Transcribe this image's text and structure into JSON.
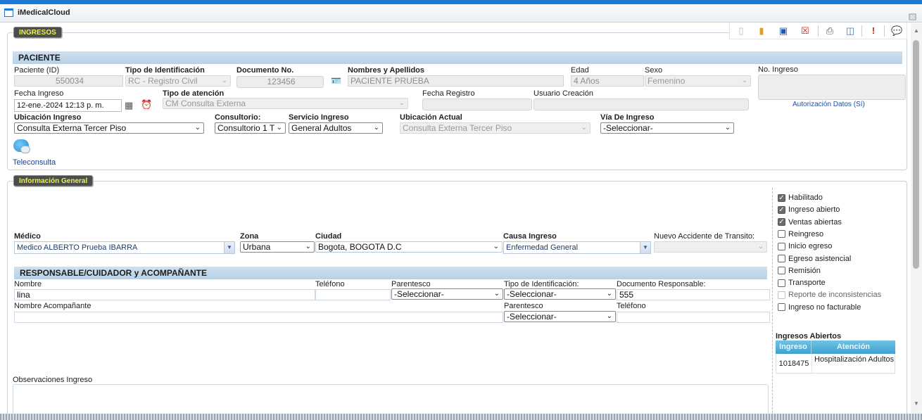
{
  "window": {
    "title": "iMedicalCloud",
    "close": "⊠"
  },
  "toolbar": {
    "icons": [
      "new-document-icon",
      "open-folder-icon",
      "save-icon",
      "delete-icon",
      "print-icon",
      "preview-icon",
      "alert-icon",
      "comment-icon"
    ]
  },
  "ingresos": {
    "title": "INGRESOS"
  },
  "paciente": {
    "header": "PACIENTE",
    "paciente_id": {
      "label": "Paciente (ID)",
      "value": "550034"
    },
    "tipo_id": {
      "label": "Tipo de Identificación",
      "value": "RC - Registro Civil"
    },
    "documento": {
      "label": "Documento No.",
      "value": "123456"
    },
    "nombres": {
      "label": "Nombres y Apellidos",
      "value": "PACIENTE  PRUEBA"
    },
    "edad": {
      "label": "Edad",
      "value": "4  Años"
    },
    "sexo": {
      "label": "Sexo",
      "value": "Femenino"
    },
    "no_ingreso": {
      "label": "No. Ingreso",
      "value": ""
    },
    "autorizacion": "Autorización Datos (Sí)",
    "fecha_ingreso": {
      "label": "Fecha Ingreso",
      "value": "12-ene.-2024 12:13 p. m."
    },
    "tipo_atencion": {
      "label": "Tipo de atención",
      "value": "CM Consulta Externa"
    },
    "fecha_registro": {
      "label": "Fecha Registro",
      "value": ""
    },
    "usuario_creacion": {
      "label": "Usuario Creación",
      "value": ""
    },
    "ubicacion_ingreso": {
      "label": "Ubicación Ingreso",
      "value": "Consulta Externa Tercer Piso"
    },
    "consultorio": {
      "label": "Consultorio:",
      "value": "Consultorio 1 T"
    },
    "servicio": {
      "label": "Servicio Ingreso",
      "value": "General Adultos"
    },
    "ubicacion_actual": {
      "label": "Ubicación Actual",
      "value": "Consulta Externa Tercer Piso"
    },
    "via_ingreso": {
      "label": "Vía De Ingreso",
      "value": "-Seleccionar-"
    },
    "teleconsulta": "Teleconsulta"
  },
  "general": {
    "title": "Información General",
    "medico": {
      "label": "Médico",
      "value": "Medico ALBERTO Prueba IBARRA"
    },
    "zona": {
      "label": "Zona",
      "value": "Urbana"
    },
    "ciudad": {
      "label": "Ciudad",
      "value": "Bogota, BOGOTA D.C"
    },
    "causa": {
      "label": "Causa Ingreso",
      "value": "Enfermedad General"
    },
    "accidente": {
      "label": "Nuevo Accidente de Transito:",
      "value": ""
    },
    "checks": [
      {
        "label": "Habilitado",
        "checked": true
      },
      {
        "label": "Ingreso abierto",
        "checked": true
      },
      {
        "label": "Ventas abiertas",
        "checked": true
      },
      {
        "label": "Reingreso",
        "checked": false
      },
      {
        "label": "Inicio egreso",
        "checked": false
      },
      {
        "label": "Egreso asistencial",
        "checked": false
      },
      {
        "label": "Remisión",
        "checked": false
      },
      {
        "label": "Transporte",
        "checked": false
      },
      {
        "label": "Reporte de inconsistencias",
        "checked": false,
        "disabled": true
      },
      {
        "label": "Ingreso no facturable",
        "checked": false
      }
    ],
    "ingresos_abiertos": {
      "title": "Ingresos Abiertos",
      "headers": [
        "Ingreso",
        "Atención"
      ],
      "rows": [
        [
          "1018475",
          "Hospitalización Adultos"
        ]
      ]
    },
    "observaciones": {
      "label": "Observaciones Ingreso",
      "value": ""
    }
  },
  "responsable": {
    "header": "RESPONSABLE/CUIDADOR y ACOMPAÑANTE",
    "nombre": {
      "label": "Nombre",
      "value": "lina"
    },
    "telefono": {
      "label": "Teléfono",
      "value": ""
    },
    "parentesco": {
      "label": "Parentesco",
      "value": "-Seleccionar-"
    },
    "tipo_id": {
      "label": "Tipo de Identificación:",
      "value": "-Seleccionar-"
    },
    "documento": {
      "label": "Documento Responsable:",
      "value": "555"
    },
    "acomp_nombre": {
      "label": "Nombre Acompañante",
      "value": ""
    },
    "acomp_parentesco": {
      "label": "Parentesco",
      "value": "-Seleccionar-"
    },
    "acomp_telefono": {
      "label": "Teléfono",
      "value": ""
    }
  }
}
